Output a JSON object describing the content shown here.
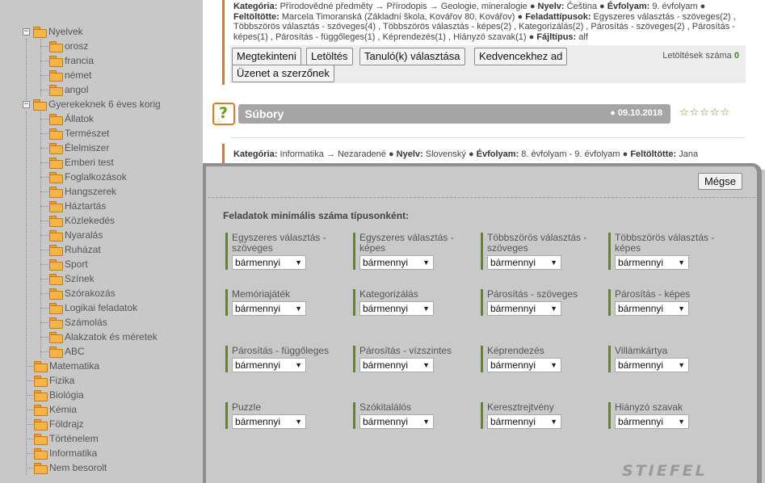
{
  "sidebar": {
    "tree": [
      {
        "label": "Nyelvek",
        "level": 0,
        "expander": "−"
      },
      {
        "label": "orosz",
        "level": 1
      },
      {
        "label": "francia",
        "level": 1
      },
      {
        "label": "német",
        "level": 1
      },
      {
        "label": "angol",
        "level": 1
      },
      {
        "label": "Gyerekeknek 6 éves korig",
        "level": 0,
        "expander": "−"
      },
      {
        "label": "Állatok",
        "level": 1
      },
      {
        "label": "Természet",
        "level": 1
      },
      {
        "label": "Élelmiszer",
        "level": 1
      },
      {
        "label": "Emberi test",
        "level": 1
      },
      {
        "label": "Foglalkozások",
        "level": 1
      },
      {
        "label": "Hangszerek",
        "level": 1
      },
      {
        "label": "Háztartás",
        "level": 1
      },
      {
        "label": "Közlekedés",
        "level": 1
      },
      {
        "label": "Nyaralás",
        "level": 1
      },
      {
        "label": "Ruházat",
        "level": 1
      },
      {
        "label": "Sport",
        "level": 1
      },
      {
        "label": "Színek",
        "level": 1
      },
      {
        "label": "Szórakozás",
        "level": 1
      },
      {
        "label": "Logikai feladatok",
        "level": 1
      },
      {
        "label": "Számolás",
        "level": 1
      },
      {
        "label": "Alakzatok és méretek",
        "level": 1
      },
      {
        "label": "ABC",
        "level": 1
      },
      {
        "label": "Matematika",
        "level": 0
      },
      {
        "label": "Fizika",
        "level": 0
      },
      {
        "label": "Biológia",
        "level": 0
      },
      {
        "label": "Kémia",
        "level": 0
      },
      {
        "label": "Földrajz",
        "level": 0
      },
      {
        "label": "Történelem",
        "level": 0
      },
      {
        "label": "Informatika",
        "level": 0
      },
      {
        "label": "Nem besorolt",
        "level": 0
      }
    ]
  },
  "entry1": {
    "line1": [
      {
        "b": "Kategória:",
        "t": " Přírodovědné předměty → Přírodopis → Geologie, mineralogie ● "
      },
      {
        "b": "Nyelv:",
        "t": " Čeština ● "
      },
      {
        "b": "Évfolyam:",
        "t": " 9. évfolyam ●"
      }
    ],
    "line2": [
      {
        "b": "Feltöltötte:",
        "t": " Marcela Timoranská (Základní škola, Kovářov 80, Kovářov) ● "
      },
      {
        "b": "Feladattípusok:",
        "t": " Egyszeres választás - szöveges(2) ,"
      }
    ],
    "line3": [
      {
        "b": "",
        "t": "Többszörös választás - szöveges(4) , Többszörös választás - képes(2) , Kategorizálás(2) , Párosítás - szöveges(2) , Párosítás -"
      }
    ],
    "line4": [
      {
        "b": "",
        "t": "képes(1) , Párosítás - függőleges(1) , Képrendezés(1) , Hiányzó szavak(1) ● "
      },
      {
        "b": "Fájltípus:",
        "t": " alf"
      }
    ],
    "buttons": {
      "view": "Megtekinteni",
      "download": "Letöltés",
      "students": "Tanuló(k) választása",
      "favorite": "Kedvencekhez ad",
      "message": "Üzenet a szerzőnek"
    },
    "downloads_label": "Letöltések száma",
    "downloads_count": "0"
  },
  "entry2": {
    "title": "Súbory",
    "date": "● 09.10.2018",
    "stars": "☆☆☆☆☆",
    "line1": [
      {
        "b": "Kategória:",
        "t": " Informatika → Nezaradené ● "
      },
      {
        "b": "Nyelv:",
        "t": " Slovenský ● "
      },
      {
        "b": "Évfolyam:",
        "t": " 8. évfolyam - 9. évfolyam ● "
      },
      {
        "b": "Feltöltötte:",
        "t": " Jana"
      }
    ]
  },
  "panel": {
    "cancel": "Mégse",
    "heading": "Feladatok minimális száma típusonként:",
    "select_value": "bármennyi",
    "fields": [
      "Egyszeres választás - szöveges",
      "Egyszeres választás - képes",
      "Többszörös választás - szöveges",
      "Többszörös választás - képes",
      "Memóriajáték",
      "Kategorizálás",
      "Párosítás - szöveges",
      "Párosítás - képes",
      "Párosítás - függőleges",
      "Párosítás - vízszintes",
      "Képrendezés",
      "Villámkártya",
      "Puzzle",
      "Szókitalálós",
      "Keresztrejtvény",
      "Hiányzó szavak"
    ]
  },
  "watermark": "STIEFEL",
  "colors": {
    "accent_orange": "#e07a1e",
    "accent_green": "#5e8a1c",
    "panel_bg": "#c9c9c9"
  }
}
